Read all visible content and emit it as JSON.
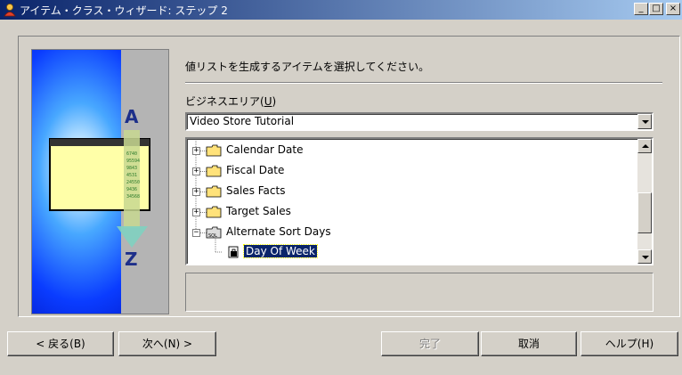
{
  "window": {
    "title": "アイテム・クラス・ウィザード: ステップ 2",
    "app_icon": "wizard-person-icon",
    "controls": {
      "minimize": "_",
      "maximize": "□",
      "close": "×"
    }
  },
  "instruction": "値リストを生成するアイテムを選択してください。",
  "business_area": {
    "label_prefix": "ビジネスエリア(",
    "label_key": "U",
    "label_suffix": ")",
    "selected": "Video Store Tutorial"
  },
  "tree": {
    "items": [
      {
        "label": "Calendar Date",
        "icon": "folder-icon",
        "expander": "+"
      },
      {
        "label": "Fiscal Date",
        "icon": "folder-icon",
        "expander": "+"
      },
      {
        "label": "Sales Facts",
        "icon": "folder-icon",
        "expander": "+"
      },
      {
        "label": "Target Sales",
        "icon": "folder-icon",
        "expander": "+"
      },
      {
        "label": "Alternate Sort Days",
        "icon": "sql-folder-icon",
        "expander": "−"
      },
      {
        "label": "Day Of Week",
        "icon": "item-icon",
        "selected": true
      }
    ]
  },
  "illustration": {
    "letter_top": "A",
    "letter_bottom": "Z",
    "list_values": [
      "6740",
      "95594",
      "9843",
      "4531",
      "24550",
      "9436",
      "34568"
    ]
  },
  "buttons": {
    "back": "< 戻る(B)",
    "next": "次へ(N) >",
    "finish": "完了",
    "cancel": "取消",
    "help": "ヘルプ(H)"
  },
  "colors": {
    "title_gradient_start": "#0a246a",
    "title_gradient_end": "#a6caf0",
    "selection": "#0a246a",
    "face": "#d4d0c8"
  }
}
